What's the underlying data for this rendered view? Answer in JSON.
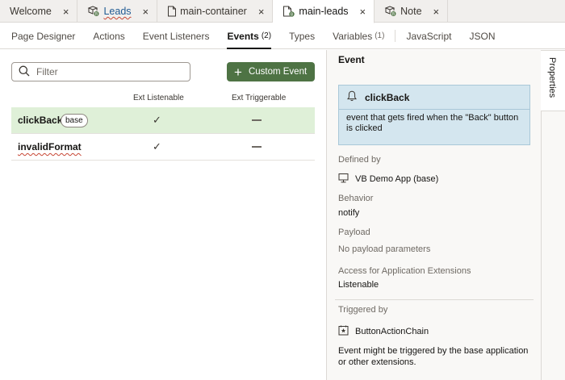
{
  "editor_tabs": [
    {
      "label": "Welcome",
      "icon": "none",
      "active": false
    },
    {
      "label": "Leads",
      "icon": "extension-app-icon",
      "active": false
    },
    {
      "label": "main-container",
      "icon": "page-icon",
      "active": false
    },
    {
      "label": "main-leads",
      "icon": "extension-page-icon",
      "active": true
    },
    {
      "label": "Note",
      "icon": "extension-app-icon",
      "active": false
    }
  ],
  "close_glyph": "×",
  "sub_tabs": [
    {
      "label": "Page Designer",
      "count": ""
    },
    {
      "label": "Actions",
      "count": ""
    },
    {
      "label": "Event Listeners",
      "count": ""
    },
    {
      "label": "Events",
      "count": "(2)"
    },
    {
      "label": "Types",
      "count": ""
    },
    {
      "label": "Variables",
      "count": "(1)"
    },
    {
      "label": "JavaScript",
      "count": ""
    },
    {
      "label": "JSON",
      "count": ""
    }
  ],
  "events": {
    "filter_placeholder": "Filter",
    "custom_event_label": "Custom Event",
    "columns": {
      "listenable": "Ext Listenable",
      "triggerable": "Ext Triggerable"
    },
    "rows": [
      {
        "name": "clickBack",
        "badge": "base",
        "listenable": "✓",
        "selected": true
      },
      {
        "name": "invalidFormat",
        "badge": "",
        "listenable": "✓",
        "selected": false
      }
    ]
  },
  "properties": {
    "section_title": "Event",
    "event_name": "clickBack",
    "event_description": "event that gets fired when the \"Back\" button is clicked",
    "defined_by_label": "Defined by",
    "defined_by_value": "VB Demo App (base)",
    "behavior_label": "Behavior",
    "behavior_value": "notify",
    "payload_label": "Payload",
    "payload_value": "No payload parameters",
    "access_label": "Access for Application Extensions",
    "access_value": "Listenable",
    "triggered_by_label": "Triggered by",
    "triggered_by_value": "ButtonActionChain",
    "triggered_note": "Event might be triggered by the base application or other extensions."
  },
  "side_tab_label": "Properties",
  "colors": {
    "accent_button": "#4e7344",
    "selected_row": "#dff0d8",
    "event_card": "#d4e6ef"
  }
}
